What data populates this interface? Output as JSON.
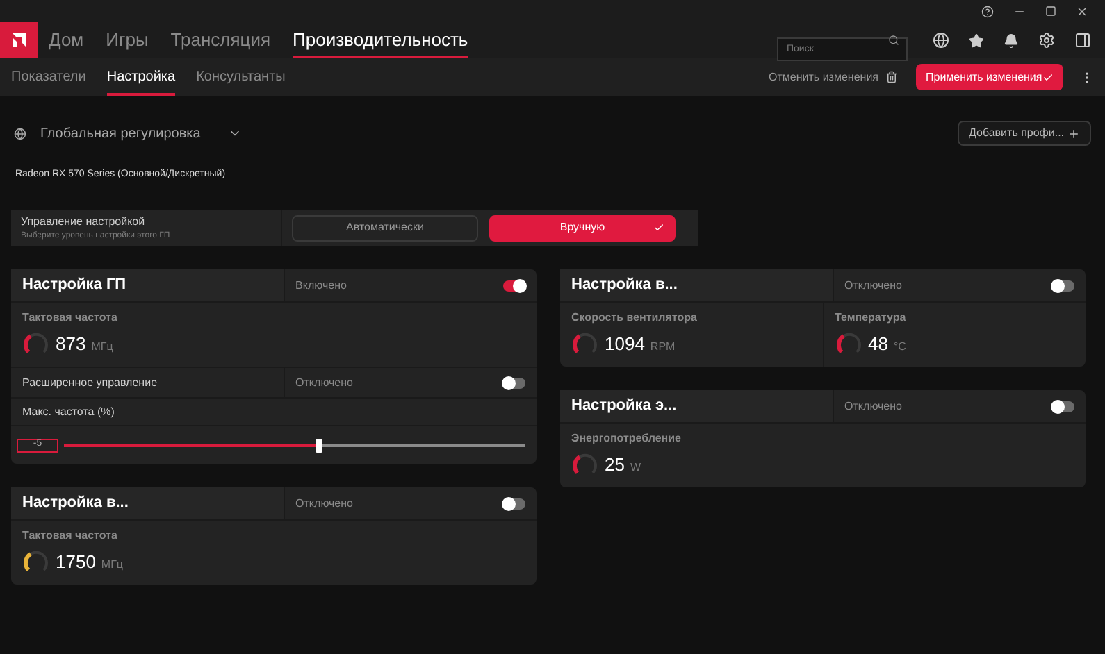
{
  "nav": {
    "tabs": [
      {
        "label": "Дом",
        "selected": false
      },
      {
        "label": "Игры",
        "selected": false
      },
      {
        "label": "Трансляция",
        "selected": false
      },
      {
        "label": "Производительность",
        "selected": true
      }
    ],
    "search": {
      "placeholder": "Поиск"
    }
  },
  "subnav": {
    "tabs": [
      {
        "label": "Показатели",
        "selected": false
      },
      {
        "label": "Настройка",
        "selected": true
      },
      {
        "label": "Консультанты",
        "selected": false
      }
    ],
    "discard": "Отменить изменения",
    "apply": "Применить изменения"
  },
  "profile": {
    "label": "Глобальная регулировка",
    "add": "Добавить профи..."
  },
  "gpu_name": "Radeon RX 570 Series (Основной/Дискретный)",
  "tuning_control": {
    "title": "Управление настройкой",
    "subtitle": "Выберите уровень настройки этого ГП",
    "options": [
      {
        "label": "Автоматически",
        "selected": false
      },
      {
        "label": "Вручную",
        "selected": true
      }
    ]
  },
  "left_column": [
    {
      "title": "Настройка ГП",
      "status": "Включено",
      "on": true,
      "metrics": [
        {
          "label": "Тактовая частота",
          "value": "873",
          "unit": "МГц",
          "color": "#d81b3c"
        }
      ],
      "advanced": {
        "label": "Расширенное управление",
        "status": "Отключено",
        "on": false
      },
      "slider": {
        "label": "Макс. частота (%)",
        "value": "-5",
        "level": 0.55
      }
    },
    {
      "title": "Настройка в...",
      "status": "Отключено",
      "on": false,
      "metrics": [
        {
          "label": "Тактовая частота",
          "value": "1750",
          "unit": "МГц",
          "color": "#e8b339"
        }
      ]
    }
  ],
  "right_column": [
    {
      "title": "Настройка в...",
      "status": "Отключено",
      "on": false,
      "metrics": [
        {
          "label": "Скорость вентилятора",
          "value": "1094",
          "unit": "RPM",
          "color": "#d81b3c"
        },
        {
          "label": "Температура",
          "value": "48",
          "unit": "°C",
          "color": "#d81b3c"
        }
      ]
    },
    {
      "title": "Настройка э...",
      "status": "Отключено",
      "on": false,
      "metrics": [
        {
          "label": "Энергопотребление",
          "value": "25",
          "unit": "W",
          "color": "#d81b3c"
        }
      ]
    }
  ]
}
